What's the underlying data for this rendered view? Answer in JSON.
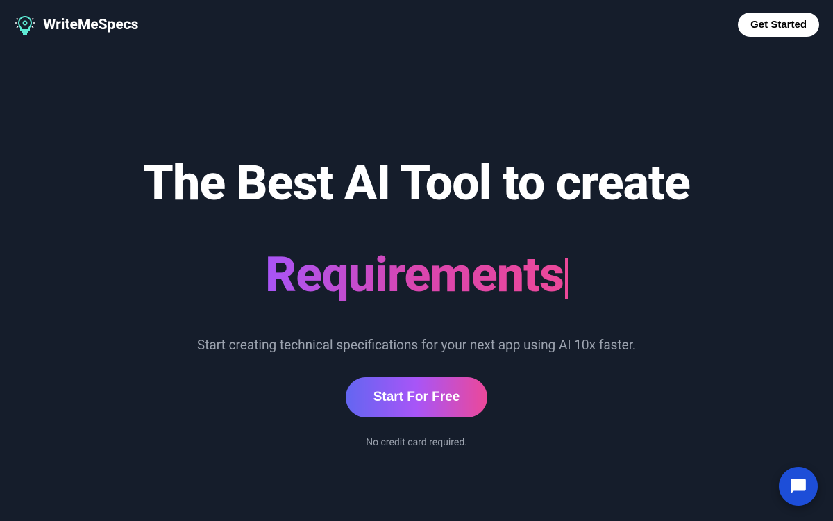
{
  "header": {
    "brand_name": "WriteMeSpecs",
    "get_started_label": "Get Started"
  },
  "hero": {
    "title": "The Best AI Tool to create",
    "animated_word": "Requirements",
    "description": "Start creating technical specifications for your next app using AI 10x faster.",
    "cta_label": "Start For Free",
    "cta_note": "No credit card required."
  }
}
